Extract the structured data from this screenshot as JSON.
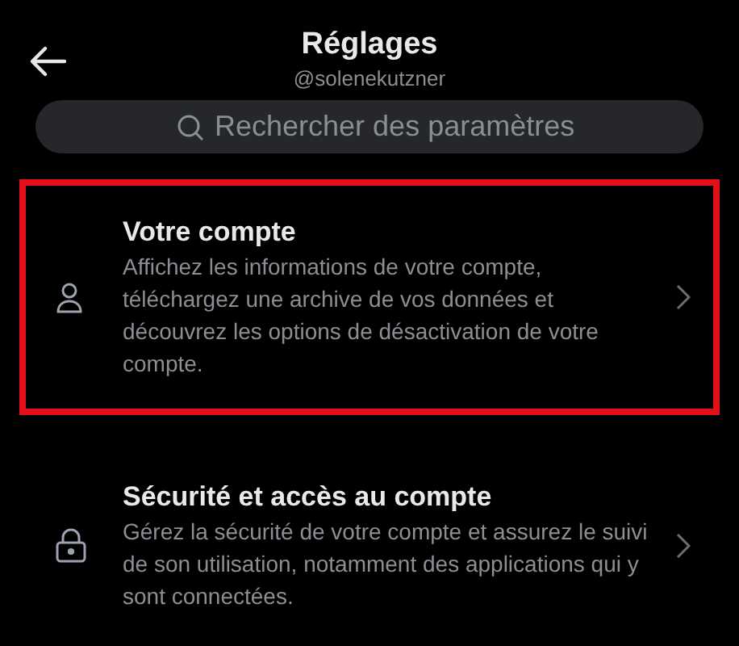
{
  "header": {
    "title": "Réglages",
    "subtitle": "@solenekutzner"
  },
  "search": {
    "placeholder": "Rechercher des paramètres"
  },
  "items": [
    {
      "kind": "account",
      "title": "Votre compte",
      "description": "Affichez les informations de votre compte, téléchargez une archive de vos données et découvrez les options de désactivation de votre compte.",
      "highlighted": true
    },
    {
      "kind": "security",
      "title": "Sécurité et accès au compte",
      "description": "Gérez la sécurité de votre compte et assurez le suivi de son utilisation, notamment des applications qui y sont connectées.",
      "highlighted": false
    }
  ]
}
